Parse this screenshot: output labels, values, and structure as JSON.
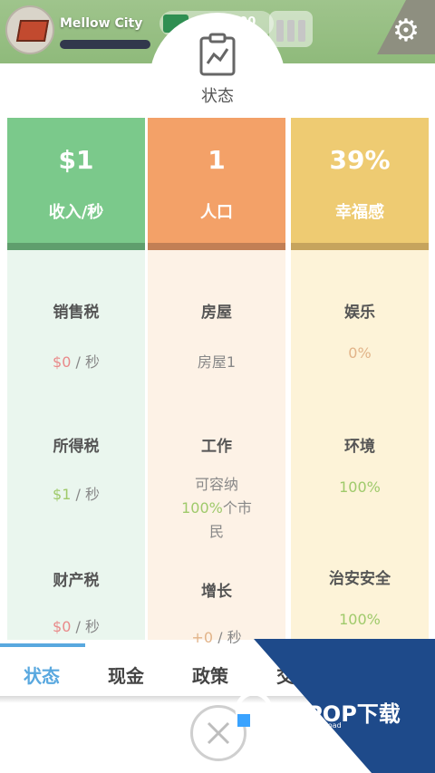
{
  "hud": {
    "city_name": "Mellow City",
    "money": "$515,200"
  },
  "panel": {
    "title": "状态",
    "income": {
      "value": "$1",
      "label": "收入/秒"
    },
    "population": {
      "value": "1",
      "label": "人口"
    },
    "happiness": {
      "value": "39%",
      "label": "幸福感"
    }
  },
  "income_items": [
    {
      "title": "销售税",
      "value": "$0",
      "unit": " / 秒"
    },
    {
      "title": "所得税",
      "value": "$1",
      "unit": " / 秒"
    },
    {
      "title": "财产税",
      "value": "$0",
      "unit": " / 秒"
    }
  ],
  "population_items": [
    {
      "title": "房屋",
      "value": "房屋1"
    },
    {
      "title": "工作",
      "line1": "可容纳",
      "value": "100%",
      "line2": "个市",
      "line3": "民"
    },
    {
      "title": "增长",
      "value": "+0",
      "unit": " / 秒"
    }
  ],
  "happiness_items": [
    {
      "title": "娱乐",
      "value": "0%"
    },
    {
      "title": "环境",
      "value": "100%"
    },
    {
      "title": "治安安全",
      "value": "100%"
    }
  ],
  "tabs": [
    "状态",
    "现金",
    "政策",
    "交通"
  ],
  "watermark": {
    "brand": "PCPOP下载",
    "sub": "PCPOP Download"
  },
  "colors": {
    "income": "#7bc98b",
    "population": "#f3a168",
    "happiness": "#eecb72",
    "tab_active": "#59a8df"
  },
  "icons": [
    "city-icon",
    "cash-icon",
    "stats-icon",
    "gear-icon",
    "clipboard-chart-icon",
    "close-icon"
  ]
}
